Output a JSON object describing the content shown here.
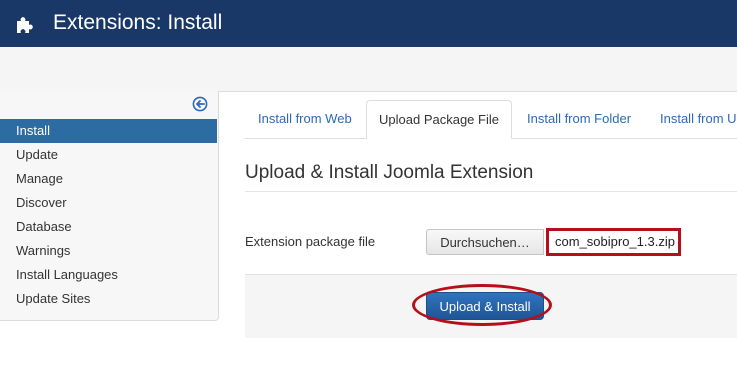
{
  "header": {
    "title": "Extensions: Install",
    "icon": "puzzle-icon"
  },
  "sidebar": {
    "toggle_icon": "arrow-circle-left-icon",
    "items": [
      {
        "label": "Install",
        "active": true
      },
      {
        "label": "Update"
      },
      {
        "label": "Manage"
      },
      {
        "label": "Discover"
      },
      {
        "label": "Database"
      },
      {
        "label": "Warnings"
      },
      {
        "label": "Install Languages"
      },
      {
        "label": "Update Sites"
      }
    ]
  },
  "tabs": [
    {
      "label": "Install from Web"
    },
    {
      "label": "Upload Package File",
      "active": true
    },
    {
      "label": "Install from Folder"
    },
    {
      "label": "Install from U"
    }
  ],
  "main": {
    "section_title": "Upload & Install Joomla Extension",
    "field_label": "Extension package file",
    "browse_label": "Durchsuchen…",
    "file_name": "com_sobipro_1.3.zip",
    "upload_label": "Upload & Install"
  },
  "colors": {
    "header_bg": "#1a3867",
    "active_nav": "#2d6ca2",
    "link": "#2a69b8",
    "highlight": "#b40f1a",
    "primary_button": "#2a6ab4"
  }
}
